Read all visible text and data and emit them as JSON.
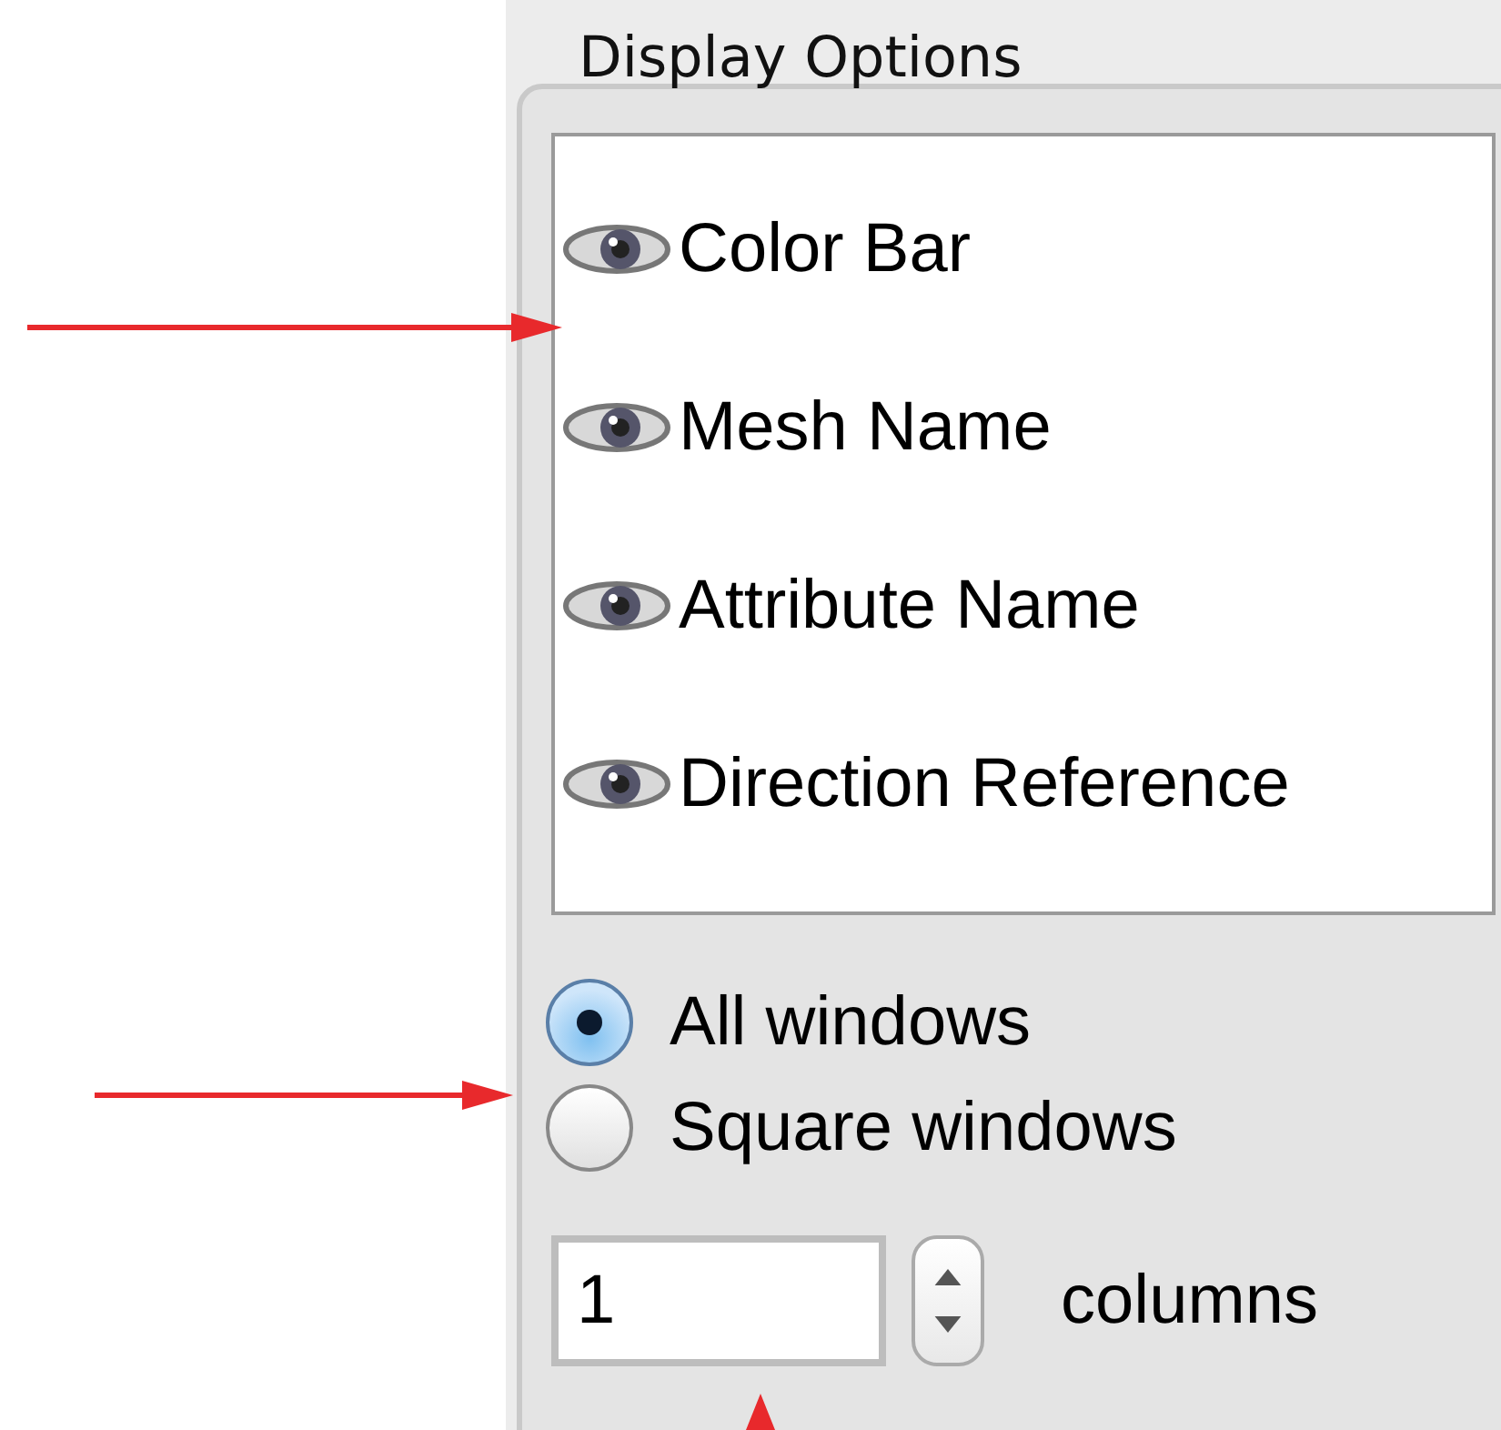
{
  "panel": {
    "title": "Display Options"
  },
  "display_items": [
    {
      "label": "Color Bar",
      "visible": true
    },
    {
      "label": "Mesh Name",
      "visible": true
    },
    {
      "label": "Attribute Name",
      "visible": true
    },
    {
      "label": "Direction Reference",
      "visible": true
    }
  ],
  "window_options": [
    {
      "label": "All windows",
      "selected": true
    },
    {
      "label": "Square windows",
      "selected": false
    }
  ],
  "columns": {
    "value": "1",
    "label": "columns"
  }
}
